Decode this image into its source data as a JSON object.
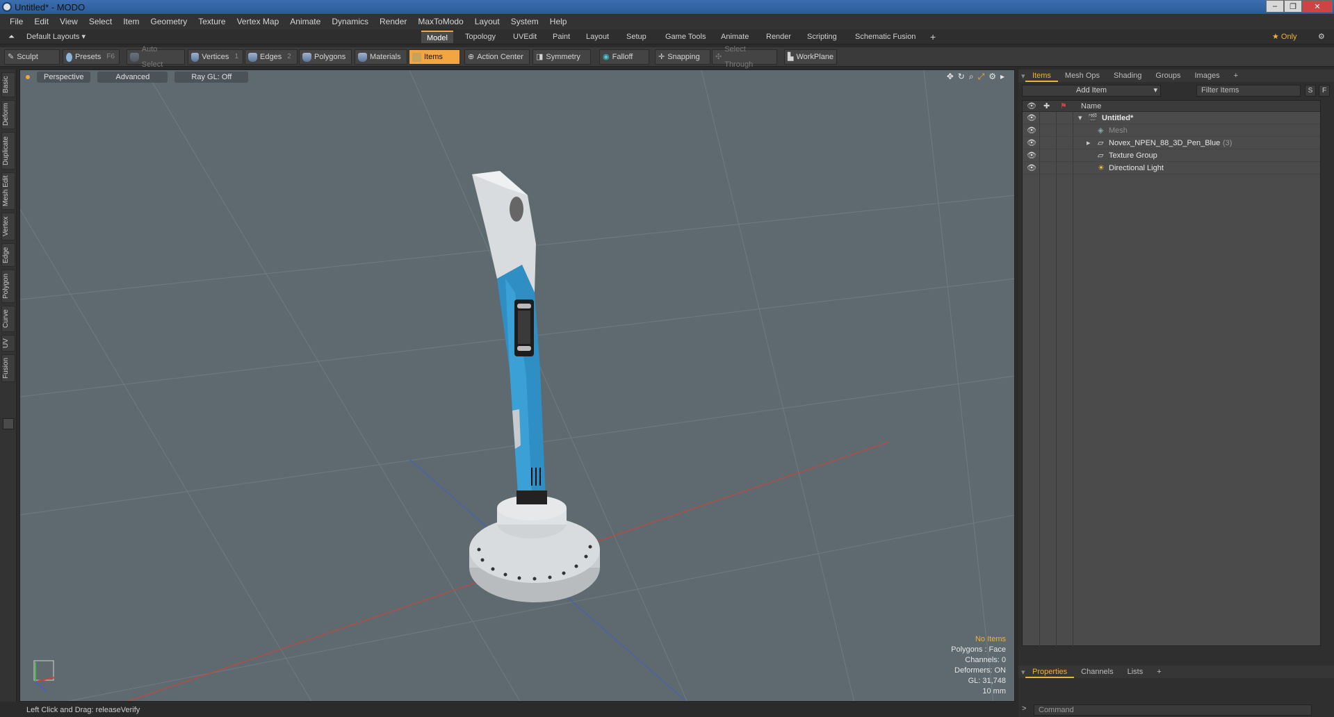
{
  "window": {
    "title": "Untitled* - MODO",
    "controls": [
      "–",
      "❐",
      "✕"
    ]
  },
  "menu": [
    "File",
    "Edit",
    "View",
    "Select",
    "Item",
    "Geometry",
    "Texture",
    "Vertex Map",
    "Animate",
    "Dynamics",
    "Render",
    "MaxToModo",
    "Layout",
    "System",
    "Help"
  ],
  "layouts": {
    "preset": "Default Layouts ▾",
    "tabs": [
      "Model",
      "Topology",
      "UVEdit",
      "Paint",
      "Layout",
      "Setup",
      "Game Tools",
      "Animate",
      "Render",
      "Scripting",
      "Schematic Fusion"
    ],
    "active": "Model",
    "add": "+",
    "only_label": "★ Only"
  },
  "toolbar": {
    "sculpt": "Sculpt",
    "presets": "Presets",
    "presets_key": "F6",
    "auto_select": "Auto Select",
    "vertices": "Vertices",
    "vertices_key": "1",
    "edges": "Edges",
    "edges_key": "2",
    "polygons": "Polygons",
    "materials": "Materials",
    "items": "Items",
    "action_center": "Action Center",
    "symmetry": "Symmetry",
    "falloff": "Falloff",
    "snapping": "Snapping",
    "select_through": "Select Through",
    "workplane": "WorkPlane"
  },
  "left_tabs": [
    "Basic",
    "Deform",
    "Duplicate",
    "Mesh Edit",
    "Vertex",
    "Edge",
    "Polygon",
    "Curve",
    "UV",
    "Fusion"
  ],
  "viewport": {
    "view": "Perspective",
    "advanced": "Advanced",
    "raygl": "Ray GL: Off",
    "info": {
      "selection": "No Items",
      "polygons": "Polygons : Face",
      "channels": "Channels: 0",
      "deformers": "Deformers: ON",
      "gl": "GL: 31,748",
      "unit": "10 mm"
    }
  },
  "items_panel": {
    "tabs": [
      "Items",
      "Mesh Ops",
      "Shading",
      "Groups",
      "Images",
      "+"
    ],
    "add_item": "Add Item",
    "filter_placeholder": "Filter Items",
    "btn_s": "S",
    "btn_f": "F",
    "column_name": "Name",
    "rows": [
      {
        "label": "Untitled*",
        "count": ""
      },
      {
        "label": "Mesh",
        "count": ""
      },
      {
        "label": "Novex_NPEN_88_3D_Pen_Blue",
        "count": "(3)"
      },
      {
        "label": "Texture Group",
        "count": ""
      },
      {
        "label": "Directional Light",
        "count": ""
      }
    ]
  },
  "properties_panel": {
    "tabs": [
      "Properties",
      "Channels",
      "Lists",
      "+"
    ]
  },
  "status": {
    "text": "Left Click and Drag:   releaseVerify"
  },
  "command": {
    "placeholder": "Command"
  },
  "colors": {
    "accent": "#f2a540",
    "viewport_bg": "#5e6a70",
    "pen_blue": "#2f8ec4"
  }
}
